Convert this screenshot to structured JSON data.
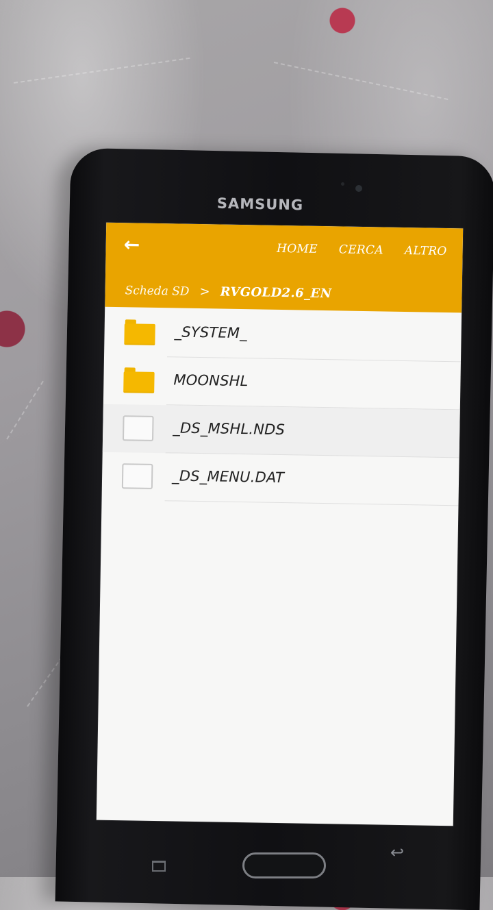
{
  "device": {
    "brand": "SAMSUNG"
  },
  "toolbar": {
    "back_label": "←",
    "actions": [
      "HOME",
      "CERCA",
      "ALTRO"
    ]
  },
  "breadcrumb": {
    "root": "Scheda SD",
    "separator": ">",
    "current": "RVGOLD2.6_EN"
  },
  "files": [
    {
      "name": "_SYSTEM_",
      "icon": "folder-icon"
    },
    {
      "name": "MOONSHL",
      "icon": "folder-icon"
    },
    {
      "name": "_DS_MSHL.NDS",
      "icon": "file-icon"
    },
    {
      "name": "_DS_MENU.DAT",
      "icon": "file-icon"
    }
  ],
  "colors": {
    "header": "#e9a400",
    "folder": "#f5b800",
    "screen_bg": "#f7f7f6"
  }
}
